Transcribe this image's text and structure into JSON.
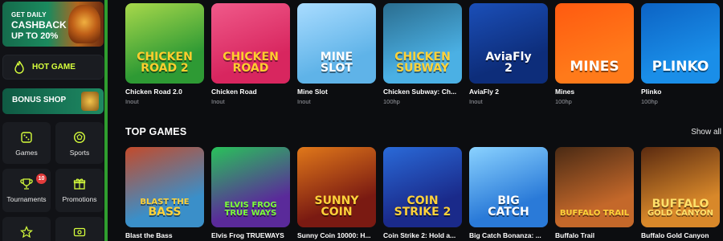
{
  "sidebar": {
    "cashback": {
      "line1": "GET DAILY",
      "line2": "CASHBACK",
      "line3": "UP TO 20%"
    },
    "hot_game": "HOT GAME",
    "bonus_shop": "BONUS SHOP",
    "tiles": [
      {
        "label": "Games",
        "icon": "dice-icon"
      },
      {
        "label": "Sports",
        "icon": "ball-icon"
      },
      {
        "label": "Tournaments",
        "icon": "trophy-icon",
        "badge": "10"
      },
      {
        "label": "Promotions",
        "icon": "gift-icon"
      },
      {
        "label": "",
        "icon": "star-icon"
      },
      {
        "label": "",
        "icon": "money-icon"
      }
    ],
    "accent": "#2f9e2f"
  },
  "row1": [
    {
      "name": "Chicken Road 2.0",
      "sub": "Inout",
      "art": [
        "CHICKEN",
        "ROAD 2"
      ],
      "bg": "#2e9a34",
      "bg2": "#a8d84b",
      "color": "#ffce2e"
    },
    {
      "name": "Chicken Road",
      "sub": "Inout",
      "art": [
        "CHICKEN",
        "ROAD"
      ],
      "bg": "#d8265f",
      "bg2": "#f05a8a",
      "color": "#ffce2e"
    },
    {
      "name": "Mine Slot",
      "sub": "Inout",
      "art": [
        "MINE",
        "SLOT"
      ],
      "bg": "#5fb3e8",
      "bg2": "#a9dcff",
      "color": "#ffffff"
    },
    {
      "name": "Chicken Subway: Ch...",
      "sub": "100hp",
      "art": [
        "CHICKEN",
        "SUBWAY"
      ],
      "bg": "#4bb0e4",
      "bg2": "#2a6d8f",
      "color": "#ffd23a"
    },
    {
      "name": "AviaFly 2",
      "sub": "Inout",
      "art": [
        "AviaFly",
        "2"
      ],
      "bg": "#0d2d7a",
      "bg2": "#1b4fb8",
      "color": "#ffffff"
    },
    {
      "name": "Mines",
      "sub": "100hp",
      "art": [
        "MINES"
      ],
      "bg": "#ff7a1a",
      "bg2": "#ff5a10",
      "color": "#ffffff"
    },
    {
      "name": "Plinko",
      "sub": "100hp",
      "art": [
        "PLINKO"
      ],
      "bg": "#1a8ee8",
      "bg2": "#0c63c4",
      "color": "#ffffff"
    }
  ],
  "section": {
    "title": "TOP GAMES",
    "show_all": "Show all"
  },
  "row2": [
    {
      "name": "Blast the Bass",
      "art": [
        "BLAST THE",
        "BASS"
      ],
      "bg": "#3a8fc9",
      "bg2": "#c44a2a",
      "color": "#ffd23a"
    },
    {
      "name": "Elvis Frog TRUEWAYS",
      "art": [
        "ELVIS FROG",
        "TRUE WAYS"
      ],
      "bg": "#5a2a9a",
      "bg2": "#29c25a",
      "color": "#7dff3a"
    },
    {
      "name": "Sunny Coin 10000: H...",
      "art": [
        "SUNNY",
        "COIN"
      ],
      "bg": "#7a1a12",
      "bg2": "#e0781a",
      "color": "#ffd23a"
    },
    {
      "name": "Coin Strike 2: Hold a...",
      "art": [
        "COIN",
        "STRIKE 2"
      ],
      "bg": "#1a2a8a",
      "bg2": "#2a6ad8",
      "color": "#ffd23a"
    },
    {
      "name": "Big Catch Bonanza: ...",
      "art": [
        "BIG",
        "CATCH"
      ],
      "bg": "#2a7ad8",
      "bg2": "#8ad2ff",
      "color": "#ffffff"
    },
    {
      "name": "Buffalo Trail",
      "art": [
        "BUFFALO TRAIL"
      ],
      "bg": "#c4682a",
      "bg2": "#4a2a14",
      "color": "#ffd23a"
    },
    {
      "name": "Buffalo Gold Canyon",
      "art": [
        "BUFFALO",
        "GOLD CANYON"
      ],
      "bg": "#d8882a",
      "bg2": "#5a2a10",
      "color": "#ffe06a"
    }
  ]
}
